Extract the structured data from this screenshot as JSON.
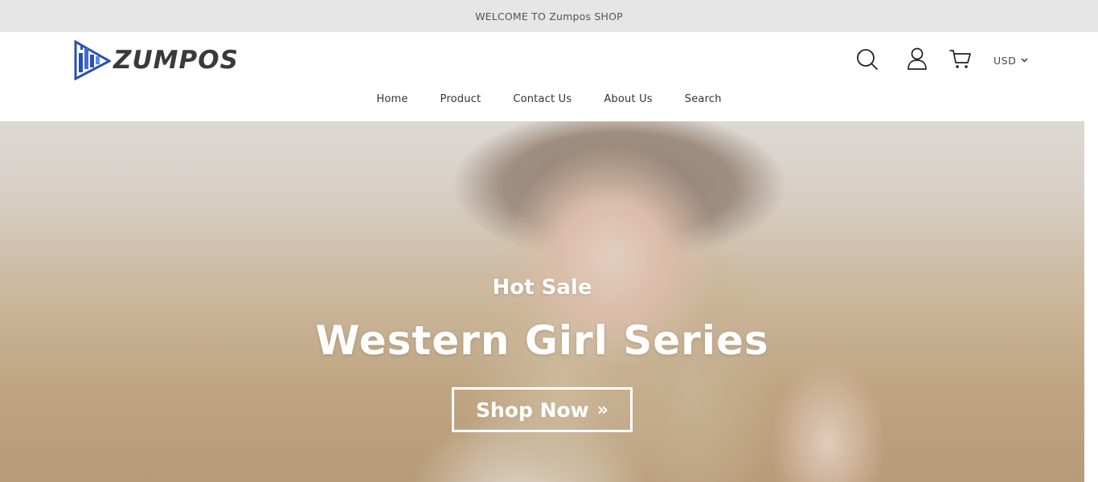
{
  "announcement": {
    "text": "WELCOME TO Zumpos SHOP"
  },
  "header": {
    "logo_text": "ZUMPOS",
    "icons": {
      "search": "search-icon",
      "account": "account-icon",
      "cart": "cart-icon",
      "chevron": "chevron-down-icon"
    },
    "currency": "USD"
  },
  "nav": {
    "items": [
      {
        "label": "Home"
      },
      {
        "label": "Product"
      },
      {
        "label": "Contact Us"
      },
      {
        "label": "About Us"
      },
      {
        "label": "Search"
      }
    ]
  },
  "hero": {
    "subtitle": "Hot Sale",
    "title": "Western Girl Series",
    "cta_label": "Shop Now",
    "cta_arrow": "»"
  },
  "colors": {
    "topbar_bg": "#e6e6e6",
    "logo_blue": "#2a4fb5",
    "logo_text": "#3a3a3a",
    "hero_text": "#ffffff"
  }
}
